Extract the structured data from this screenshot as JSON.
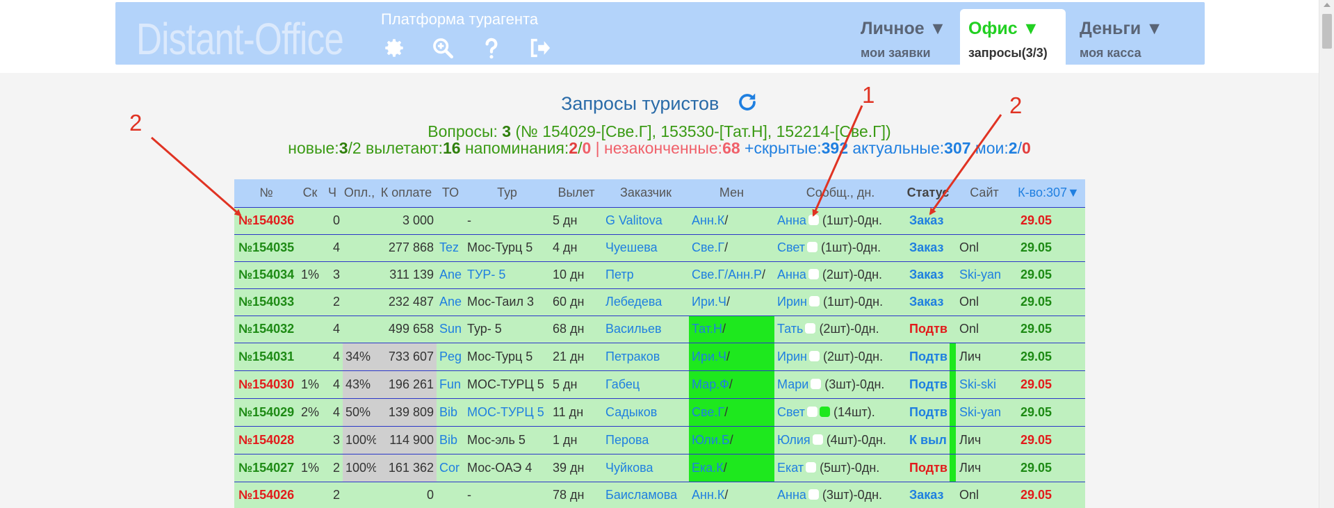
{
  "header": {
    "logo": "Distant-Office",
    "platform": "Платформа турагента",
    "icons": [
      "gear-icon",
      "zoom-in-icon",
      "help-icon",
      "logout-icon"
    ],
    "menus": [
      {
        "title": "Личное ▼",
        "sub": "мои заявки"
      },
      {
        "title": "Офис ▼",
        "sub": "запросы(3/3)",
        "active": true
      },
      {
        "title": "Деньги ▼",
        "sub": "моя касса"
      }
    ]
  },
  "summary": {
    "title": "Запросы туристов",
    "questions_label": "Вопросы: ",
    "questions_count": "3",
    "questions_list": " (№ 154029-[Све.Г], 153530-[Тат.Н], 152214-[Све.Г])",
    "new_label": "новые:",
    "new_a": "3",
    "new_b": "/2",
    "depart_label": " вылетают:",
    "depart": "16",
    "remind_label": " напоминания:",
    "remind_a": "2",
    "remind_b": "0",
    "sep": " | ",
    "unfinished_label": "незаконченные:",
    "unfinished": "68",
    "hidden_label": " +скрытые:",
    "hidden": "392",
    "actual_label": " актуальные:",
    "actual": "307",
    "mine_label": " мои:",
    "mine_a": "2",
    "mine_b": "0"
  },
  "table": {
    "headers": {
      "num": "№",
      "sk": "Ск",
      "ch": "Ч",
      "opl": "Опл.,",
      "pay": "К оплате",
      "to": "ТО",
      "tour": "Тур",
      "dep": "Вылет",
      "cust": "Заказчик",
      "men": "Мен",
      "msg": "Сообщ., дн.",
      "status": "Статус",
      "site": "Сайт",
      "count": "К-во:307▼"
    },
    "rows": [
      {
        "num": "154036",
        "numColor": "red",
        "sk": "",
        "ch": "0",
        "opl": "",
        "pay": "3 000",
        "to": "",
        "tour": "-",
        "tourLink": false,
        "dep": "5 дн",
        "cust": "G Valitova",
        "men": "Анн.К",
        "menHl": false,
        "msgName": "Анна",
        "msgRest": " (1шт)-0дн.",
        "dots": 1,
        "status": "Заказ",
        "statusColor": "blue",
        "bar": false,
        "site": "",
        "siteLink": false,
        "date": "29.05",
        "dateColor": "red"
      },
      {
        "num": "154035",
        "numColor": "green",
        "sk": "",
        "ch": "4",
        "opl": "",
        "pay": "277 868",
        "to": "Tez",
        "tour": "Мос-Турц 5",
        "tourLink": false,
        "dep": "4 дн",
        "cust": "Чуешева",
        "men": "Све.Г",
        "menHl": false,
        "msgName": "Свет",
        "msgRest": " (1шт)-0дн.",
        "dots": 1,
        "status": "Заказ",
        "statusColor": "blue",
        "bar": false,
        "site": "Onl",
        "siteLink": false,
        "date": "29.05",
        "dateColor": "green"
      },
      {
        "num": "154034",
        "numColor": "green",
        "sk": "1%",
        "ch": "3",
        "opl": "",
        "pay": "311 139",
        "to": "Ane",
        "tour": "ТУР- 5",
        "tourLink": true,
        "dep": "10 дн",
        "cust": "Петр",
        "men": "Све.Г/Анн.Р",
        "menHl": false,
        "msgName": "Анна",
        "msgRest": " (2шт)-0дн.",
        "dots": 1,
        "status": "Заказ",
        "statusColor": "blue",
        "bar": false,
        "site": "Ski-yan",
        "siteLink": true,
        "date": "29.05",
        "dateColor": "green"
      },
      {
        "num": "154033",
        "numColor": "green",
        "sk": "",
        "ch": "2",
        "opl": "",
        "pay": "232 487",
        "to": "Ane",
        "tour": "Мос-Таил 3",
        "tourLink": false,
        "dep": "60 дн",
        "cust": "Лебедева",
        "men": "Ири.Ч",
        "menHl": false,
        "msgName": "Ирин",
        "msgRest": " (1шт)-0дн.",
        "dots": 1,
        "status": "Заказ",
        "statusColor": "blue",
        "bar": false,
        "site": "Onl",
        "siteLink": false,
        "date": "29.05",
        "dateColor": "green"
      },
      {
        "num": "154032",
        "numColor": "green",
        "sk": "",
        "ch": "4",
        "opl": "",
        "pay": "499 658",
        "to": "Sun",
        "tour": "Тур- 5",
        "tourLink": false,
        "dep": "68 дн",
        "cust": "Васильев",
        "men": "Тат.Н",
        "menHl": true,
        "msgName": "Тать",
        "msgRest": " (2шт)-0дн.",
        "dots": 1,
        "status": "Подтв",
        "statusColor": "red",
        "bar": false,
        "site": "Onl",
        "siteLink": false,
        "date": "29.05",
        "dateColor": "green"
      },
      {
        "num": "154031",
        "numColor": "green",
        "sk": "",
        "ch": "4",
        "opl": "34%",
        "pay": "733 607",
        "to": "Peg",
        "tour": "Мос-Турц 5",
        "tourLink": false,
        "dep": "21 дн",
        "cust": "Петраков",
        "men": "Ири.Ч",
        "menHl": true,
        "msgName": "Ирин",
        "msgRest": " (2шт)-0дн.",
        "dots": 1,
        "status": "Подтв",
        "statusColor": "blue",
        "bar": true,
        "site": "Лич",
        "siteLink": false,
        "date": "29.05",
        "dateColor": "green"
      },
      {
        "num": "154030",
        "numColor": "red",
        "sk": "1%",
        "ch": "4",
        "opl": "43%",
        "pay": "196 261",
        "to": "Fun",
        "tour": "МОС-ТУРЦ 5",
        "tourLink": false,
        "dep": "5 дн",
        "cust": "Габец",
        "men": "Мар.Ф",
        "menHl": true,
        "msgName": "Мари",
        "msgRest": " (3шт)-0дн.",
        "dots": 1,
        "status": "Подтв",
        "statusColor": "blue",
        "bar": true,
        "site": "Ski-ski",
        "siteLink": true,
        "date": "29.05",
        "dateColor": "red"
      },
      {
        "num": "154029",
        "numColor": "green",
        "sk": "2%",
        "ch": "4",
        "opl": "50%",
        "pay": "139 809",
        "to": "Bib",
        "tour": "МОС-ТУРЦ 5",
        "tourLink": true,
        "dep": "11 дн",
        "cust": "Садыков",
        "men": "Све.Г",
        "menHl": true,
        "msgName": "Свет",
        "msgRest": " (14шт).",
        "dots": 2,
        "status": "Подтв",
        "statusColor": "blue",
        "bar": true,
        "site": "Ski-yan",
        "siteLink": true,
        "date": "29.05",
        "dateColor": "green"
      },
      {
        "num": "154028",
        "numColor": "red",
        "sk": "",
        "ch": "3",
        "opl": "100%",
        "pay": "114 900",
        "to": "Bib",
        "tour": "Мос-эль 5",
        "tourLink": false,
        "dep": "1 дн",
        "cust": "Перова",
        "men": "Юли.Б",
        "menHl": true,
        "msgName": "Юлия",
        "msgRest": " (4шт)-0дн.",
        "dots": 1,
        "status": "К выл",
        "statusColor": "blue",
        "bar": true,
        "site": "Лич",
        "siteLink": false,
        "date": "29.05",
        "dateColor": "red"
      },
      {
        "num": "154027",
        "numColor": "green",
        "sk": "1%",
        "ch": "2",
        "opl": "100%",
        "pay": "161 362",
        "to": "Cor",
        "tour": "Мос-ОАЭ 4",
        "tourLink": false,
        "dep": "39 дн",
        "cust": "Чуйкова",
        "men": "Ека.К",
        "menHl": true,
        "msgName": "Екат",
        "msgRest": " (5шт)-0дн.",
        "dots": 1,
        "status": "Подтв",
        "statusColor": "red",
        "bar": true,
        "site": "Лич",
        "siteLink": false,
        "date": "29.05",
        "dateColor": "green"
      },
      {
        "num": "154026",
        "numColor": "red",
        "sk": "",
        "ch": "2",
        "opl": "",
        "pay": "0",
        "to": "",
        "tour": "-",
        "tourLink": false,
        "dep": "78 дн",
        "cust": "Баисламова",
        "men": "Анн.К",
        "menHl": false,
        "msgName": "Анна",
        "msgRest": " (3шт)-0дн.",
        "dots": 1,
        "status": "Заказ",
        "statusColor": "blue",
        "bar": false,
        "site": "Onl",
        "siteLink": false,
        "date": "29.05",
        "dateColor": "red"
      }
    ]
  },
  "annotations": {
    "label1": "1",
    "label2a": "2",
    "label2b": "2",
    "color": "#e03323"
  },
  "colors": {
    "header_bg": "#b3d3fa",
    "row_bg": "#bff0bf",
    "highlight": "#1ee81e",
    "link": "#1f7fe0"
  }
}
